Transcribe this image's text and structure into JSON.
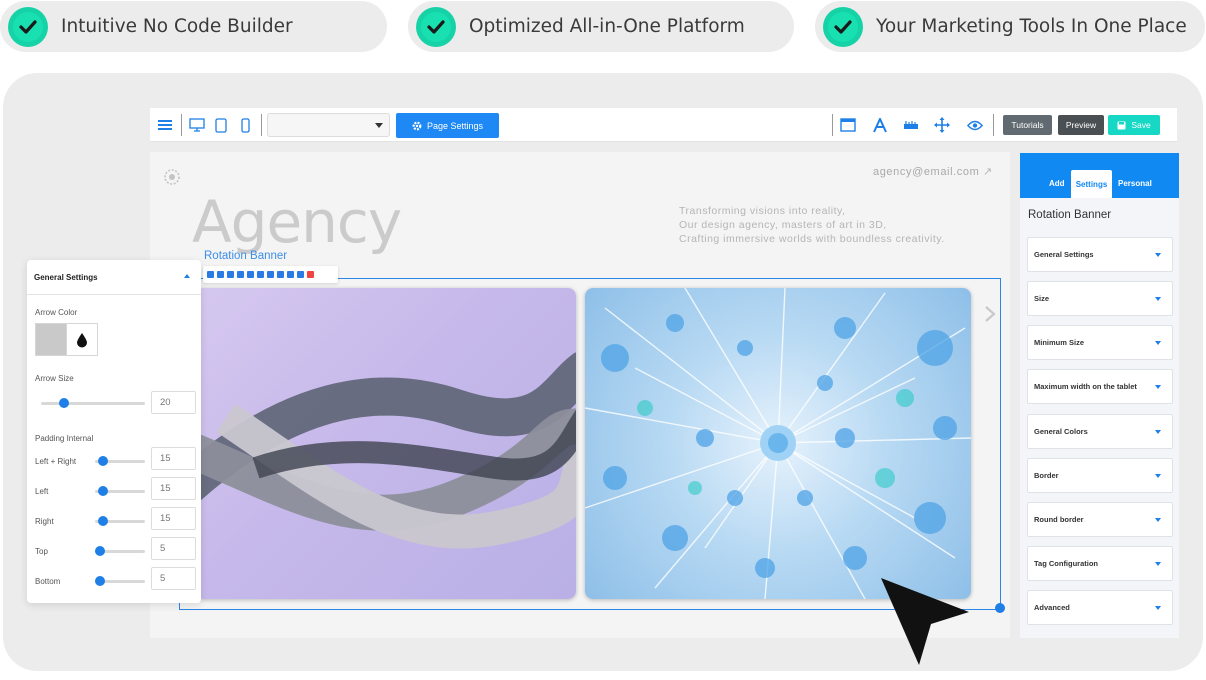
{
  "features": [
    {
      "label": "Intuitive No Code Builder"
    },
    {
      "label": "Optimized All-in-One Platform"
    },
    {
      "label": "Your Marketing Tools In One Place"
    }
  ],
  "toolbar": {
    "device_select_value": "",
    "page_settings_label": "Page Settings",
    "tutorials_label": "Tutorials",
    "preview_label": "Preview",
    "save_label": "Save"
  },
  "canvas": {
    "email": "agency@email.com",
    "heading": "Agency",
    "tagline": [
      "Transforming visions into reality,",
      "Our design agency, masters of art in 3D,",
      "Crafting immersive worlds with boundless creativity."
    ],
    "selected_element_label": "Rotation Banner"
  },
  "side_panel": {
    "tabs": [
      {
        "label": "Add"
      },
      {
        "label": "Settings"
      },
      {
        "label": "Personal"
      }
    ],
    "active_tab": "Settings",
    "title": "Rotation Banner",
    "sections": [
      {
        "label": "General Settings"
      },
      {
        "label": "Size"
      },
      {
        "label": "Minimum Size"
      },
      {
        "label": "Maximum width on the tablet"
      },
      {
        "label": "General Colors"
      },
      {
        "label": "Border"
      },
      {
        "label": "Round border"
      },
      {
        "label": "Tag Configuration"
      },
      {
        "label": "Advanced"
      }
    ]
  },
  "general_settings": {
    "title": "General Settings",
    "arrow_color_label": "Arrow Color",
    "arrow_size_label": "Arrow Size",
    "arrow_size_value": "20",
    "padding_label": "Padding Internal",
    "padding": [
      {
        "label": "Left + Right",
        "value": "15"
      },
      {
        "label": "Left",
        "value": "15"
      },
      {
        "label": "Right",
        "value": "15"
      },
      {
        "label": "Top",
        "value": "5"
      },
      {
        "label": "Bottom",
        "value": "5"
      }
    ]
  },
  "colors": {
    "accent": "#1189f2",
    "check": "#16d2a7",
    "save": "#16d8c4",
    "dark_button": "#616a70"
  }
}
